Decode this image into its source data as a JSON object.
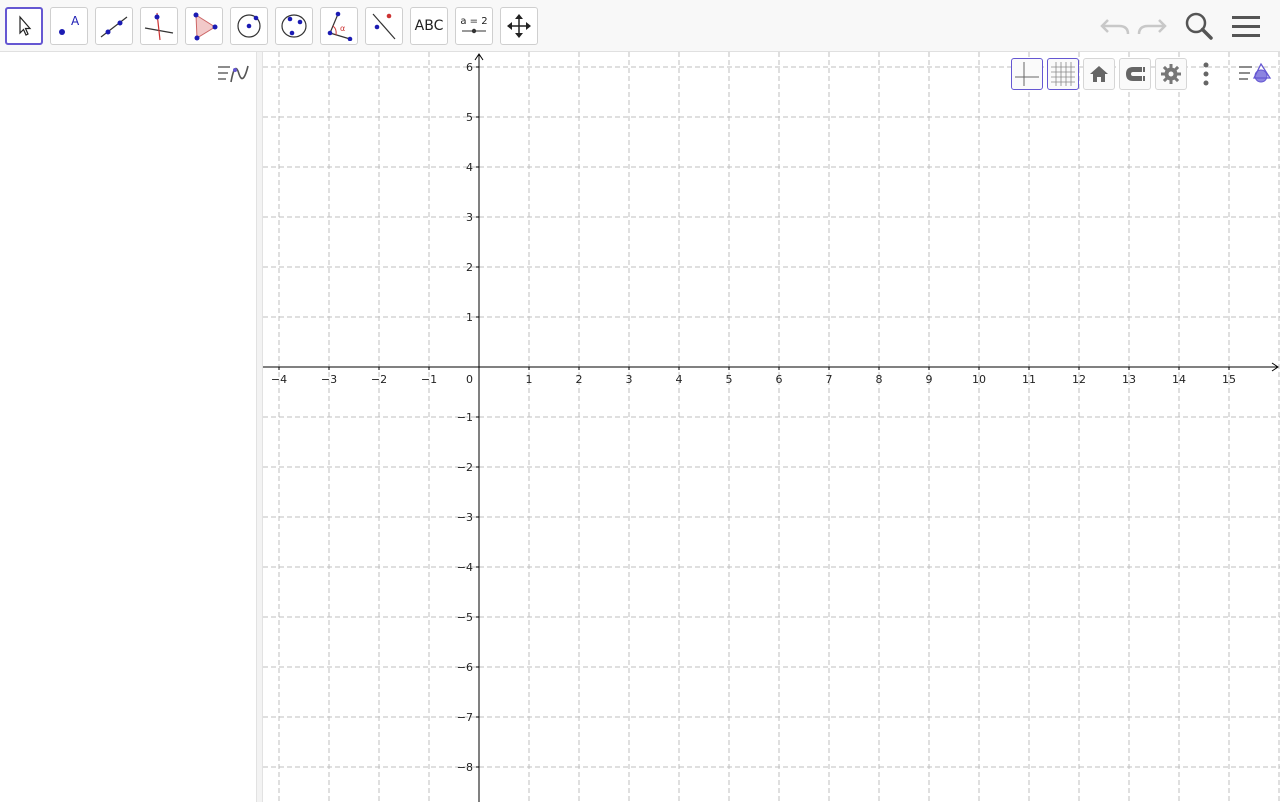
{
  "toolbar": {
    "tools": [
      {
        "id": "move",
        "icon": "move-pointer-icon"
      },
      {
        "id": "point",
        "icon": "point-icon",
        "label": "A"
      },
      {
        "id": "line",
        "icon": "line-through-two-points-icon"
      },
      {
        "id": "perpendicular",
        "icon": "perpendicular-line-icon"
      },
      {
        "id": "polygon",
        "icon": "polygon-icon"
      },
      {
        "id": "circle",
        "icon": "circle-center-point-icon"
      },
      {
        "id": "circle3",
        "icon": "circle-three-points-icon"
      },
      {
        "id": "angle",
        "icon": "angle-icon",
        "label": "α"
      },
      {
        "id": "reflect",
        "icon": "reflect-about-line-icon"
      },
      {
        "id": "text",
        "icon": "text-icon",
        "label": "ABC"
      },
      {
        "id": "slider",
        "icon": "slider-icon",
        "label": "a = 2"
      },
      {
        "id": "move-view",
        "icon": "move-graphics-view-icon"
      }
    ],
    "selected_tool": "move",
    "right": [
      "undo-icon",
      "redo-icon",
      "search-icon",
      "menu-icon"
    ]
  },
  "algebra": {
    "style_icon": "algebra-style-icon"
  },
  "graphics_bar": [
    "axes-toggle-icon",
    "grid-toggle-icon",
    "home-icon",
    "magnet-icon",
    "settings-gear-icon",
    "more-vertical-icon",
    "style-bar-icon"
  ],
  "graph": {
    "x_ticks": [
      "−4",
      "−3",
      "−2",
      "−1",
      "1",
      "2",
      "3",
      "4",
      "5",
      "6",
      "7",
      "8",
      "9",
      "10",
      "11",
      "12",
      "13",
      "14",
      "15"
    ],
    "x_values": [
      -4,
      -3,
      -2,
      -1,
      1,
      2,
      3,
      4,
      5,
      6,
      7,
      8,
      9,
      10,
      11,
      12,
      13,
      14,
      15
    ],
    "y_ticks": [
      "6",
      "5",
      "4",
      "3",
      "2",
      "1",
      "−1",
      "−2",
      "−3",
      "−4",
      "−5",
      "−6",
      "−7",
      "−8"
    ],
    "y_values": [
      6,
      5,
      4,
      3,
      2,
      1,
      -1,
      -2,
      -3,
      -4,
      -5,
      -6,
      -7,
      -8
    ],
    "origin_label": "0",
    "grid": true,
    "axis_color": "#000000",
    "grid_color": "#bfbfbf"
  },
  "colors": {
    "accent": "#6557d2",
    "point": "#1b1bb3",
    "red": "#cc3333"
  }
}
